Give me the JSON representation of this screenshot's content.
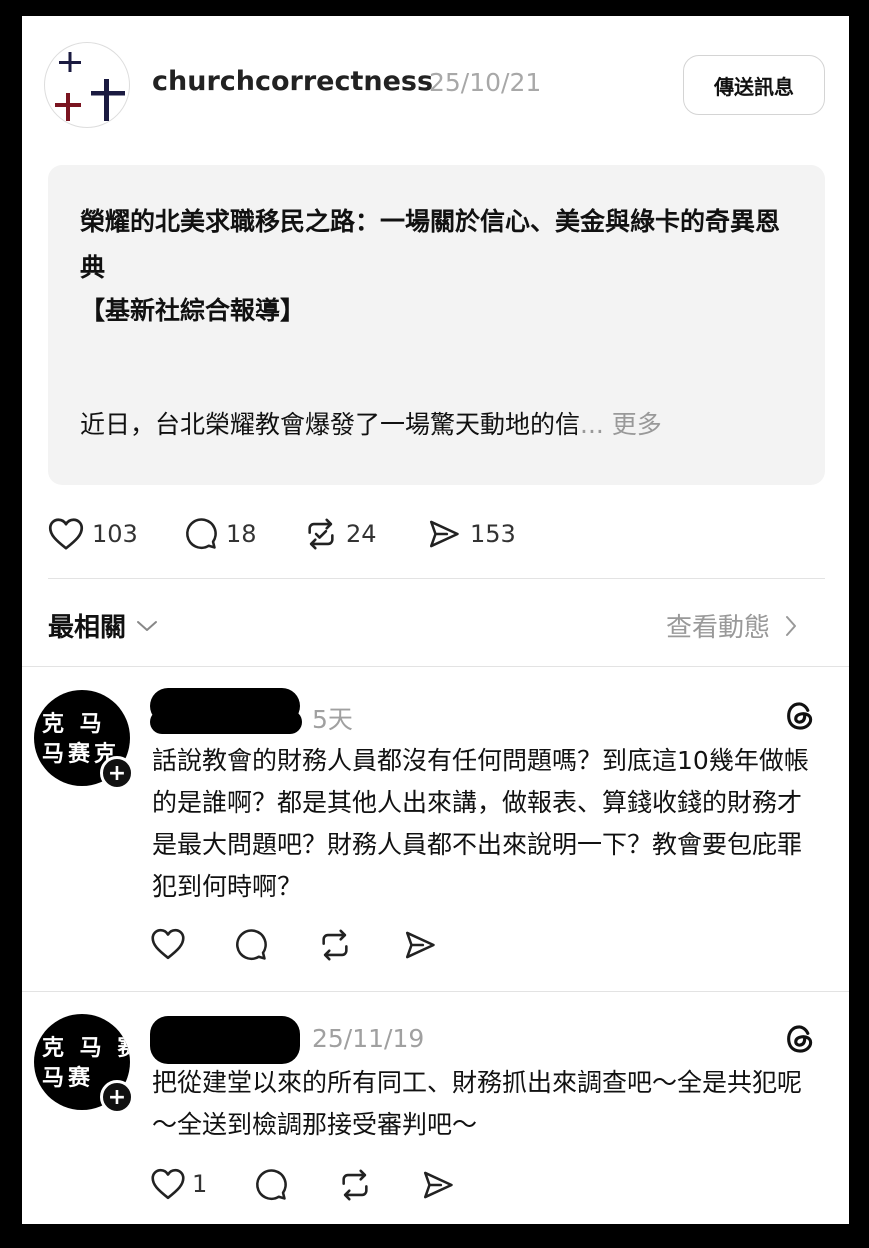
{
  "post": {
    "username": "churchcorrectness",
    "date": "25/10/21",
    "send_message_label": "傳送訊息",
    "quote": {
      "title": "榮耀的北美求職移民之路：一場關於信心、美金與綠卡的奇異恩典",
      "source": "【基新社綜合報導】",
      "body": "近日，台北榮耀教會爆發了一場驚天動地的信",
      "more_label": "... 更多"
    },
    "stats": {
      "likes": "103",
      "comments": "18",
      "reposts": "24",
      "shares": "153"
    }
  },
  "replies_header": {
    "sort_label": "最相關",
    "activity_label": "查看動態"
  },
  "replies": [
    {
      "time": "5天",
      "text": "話說教會的財務人員都沒有任何問題嗎？到底這10幾年做帳的是誰啊？都是其他人出來講，做報表、算錢收錢的財務才是最大問題吧？財務人員都不出來說明一下？教會要包庇罪犯到何時啊？",
      "like_count": ""
    },
    {
      "time": "25/11/19",
      "text": "把從建堂以來的所有同工、財務抓出來調查吧～全是共犯呢～全送到檢調那接受審判吧～",
      "like_count": "1"
    }
  ],
  "icons": {
    "heart": "heart-icon",
    "comment": "comment-icon",
    "repost": "repost-icon",
    "share": "share-icon",
    "threads": "threads-icon",
    "chevron_down": "chevron-down-icon",
    "chevron_right": "chevron-right-icon"
  }
}
